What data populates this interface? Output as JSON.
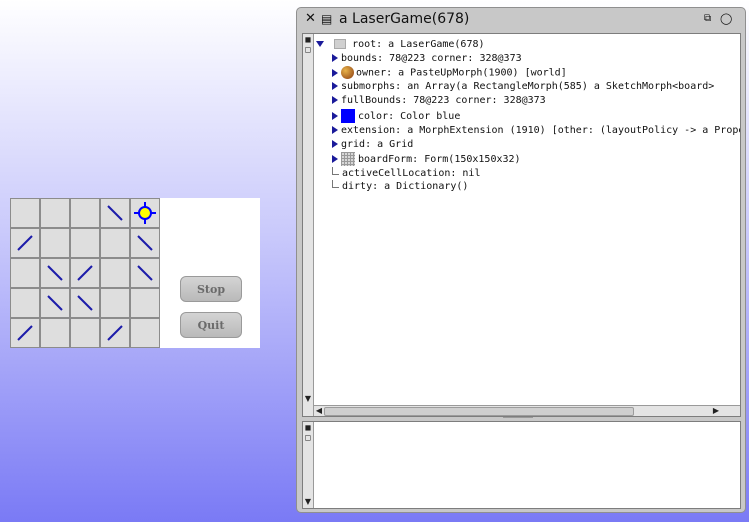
{
  "game": {
    "buttons": {
      "stop_label": "Stop",
      "quit_label": "Quit"
    },
    "grid": [
      [
        "empty",
        "empty",
        "empty",
        "mirror-backslash",
        "target"
      ],
      [
        "mirror-slash",
        "empty",
        "empty",
        "empty",
        "mirror-backslash"
      ],
      [
        "empty",
        "mirror-backslash",
        "mirror-slash",
        "empty",
        "mirror-backslash"
      ],
      [
        "empty",
        "mirror-backslash",
        "mirror-backslash",
        "empty",
        "empty"
      ],
      [
        "mirror-slash",
        "empty",
        "empty",
        "mirror-slash",
        "empty"
      ]
    ],
    "colors": {
      "mirror": "#1c1caa",
      "target": "#0000ff",
      "target_fill": "#ffff00"
    }
  },
  "inspector": {
    "title": "a LaserGame(678)",
    "root_label": "root: a LaserGame(678)",
    "items": [
      {
        "text": "bounds: 78@223 corner: 328@373",
        "expandable": true,
        "icon": ""
      },
      {
        "text": "owner: a PasteUpMorph(1900) [world]",
        "expandable": true,
        "icon": "world-icon"
      },
      {
        "text": "submorphs: an Array(a RectangleMorph(585) a SketchMorph<board>",
        "expandable": true,
        "icon": ""
      },
      {
        "text": "fullBounds: 78@223 corner: 328@373",
        "expandable": true,
        "icon": ""
      },
      {
        "text": "color: Color blue",
        "expandable": true,
        "icon": "color-swatch"
      },
      {
        "text": "extension: a MorphExtension (1910) [other:  (layoutPolicy -> a Prope",
        "expandable": true,
        "icon": ""
      },
      {
        "text": "grid: a Grid",
        "expandable": true,
        "icon": ""
      },
      {
        "text": "boardForm: Form(150x150x32)",
        "expandable": true,
        "icon": "board-thumbnail"
      },
      {
        "text": "activeCellLocation: nil",
        "expandable": false,
        "icon": ""
      },
      {
        "text": "dirty: a Dictionary()",
        "expandable": false,
        "icon": ""
      }
    ],
    "colors": {
      "swatch": "#0000ff",
      "expander": "#1a1a9a"
    }
  }
}
